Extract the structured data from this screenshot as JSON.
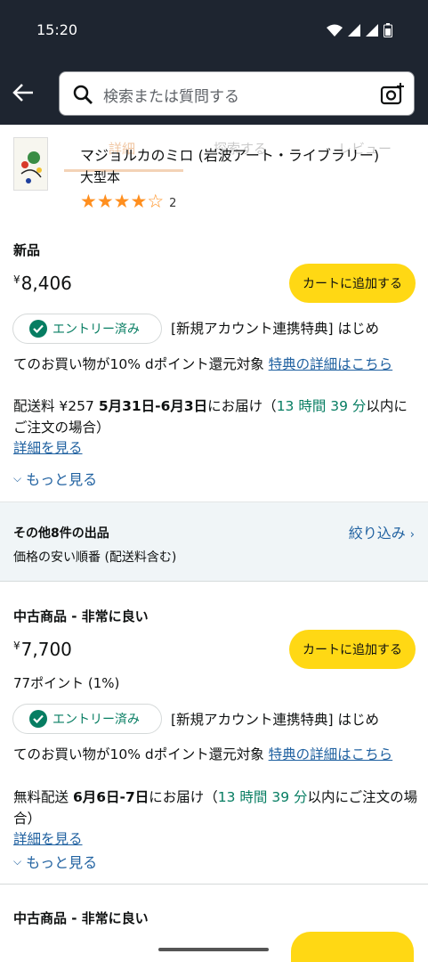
{
  "status_bar": {
    "time": "15:20"
  },
  "search": {
    "placeholder": "検索または質問する"
  },
  "header_tabs": [
    "詳細",
    "探索する",
    "レビュー"
  ],
  "product": {
    "title": "マジョルカのミロ (岩波アート・ライブラリー)",
    "format": "大型本",
    "rating_stars": 4,
    "rating_max": 5,
    "rating_count": "2"
  },
  "offer_new": {
    "condition": "新品",
    "currency": "¥",
    "price": "8,406",
    "cart_label": "カートに追加する",
    "entry_label": "エントリー済み",
    "promo_line1": "[新規アカウント連携特典] はじめ",
    "promo_line2": "てのお買い物が10% dポイント還元対象 ",
    "promo_link": "特典の詳細はこちら",
    "shipping_prefix": "配送料 ¥257 ",
    "delivery_dates": "5月31日-6月3日",
    "delivery_mid": "にお届け（",
    "delivery_time": "13 時間 39 分",
    "delivery_suffix": "以内にご注文の場合）",
    "details_link": "詳細を見る",
    "more_label": "もっと見る"
  },
  "others": {
    "title": "その他8件の出品",
    "subtitle": "価格の安い順番 (配送料含む)",
    "filter_label": "絞り込み"
  },
  "offer_used": {
    "condition": "中古商品 - 非常に良い",
    "currency": "¥",
    "price": "7,700",
    "points": "77ポイント (1%)",
    "cart_label": "カートに追加する",
    "entry_label": "エントリー済み",
    "promo_line1": "[新規アカウント連携特典] はじめ",
    "promo_line2": "てのお買い物が10% dポイント還元対象 ",
    "promo_link": "特典の詳細はこちら",
    "shipping_prefix": "無料配送 ",
    "delivery_dates": "6月6日-7日",
    "delivery_mid": "にお届け（",
    "delivery_time": "13 時間 39 分",
    "delivery_suffix": "以内にご注文の場合）",
    "details_link": "詳細を見る",
    "more_label": "もっと見る"
  },
  "offer_used2": {
    "condition": "中古商品 - 非常に良い"
  },
  "colors": {
    "header_bg": "#1e2530",
    "cart_button": "#ffd814",
    "link": "#2162a1",
    "teal": "#067d62",
    "star": "#ff8f1f"
  }
}
